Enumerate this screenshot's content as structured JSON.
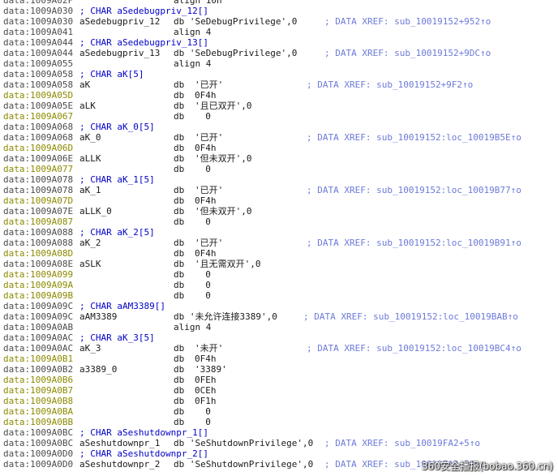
{
  "listing": [
    {
      "addr": "data:1009A02F",
      "hl": false,
      "ins": "align 10h"
    },
    {
      "addr": "data:1009A030",
      "hl": false,
      "comment": "; CHAR aSedebugpriv_12[]"
    },
    {
      "addr": "data:1009A030",
      "hl": false,
      "label": "aSedebugpriv_12",
      "inline": "db 'SeDebugPrivilege',0",
      "xref": "; DATA XREF: sub_10019152+952↑o"
    },
    {
      "addr": "data:1009A041",
      "hl": false,
      "ins": "align 4"
    },
    {
      "addr": "data:1009A044",
      "hl": false,
      "comment": "; CHAR aSedebugpriv_13[]"
    },
    {
      "addr": "data:1009A044",
      "hl": false,
      "label": "aSedebugpriv_13",
      "inline": "db 'SeDebugPrivilege',0",
      "xref": "; DATA XREF: sub_10019152+9DC↑o"
    },
    {
      "addr": "data:1009A055",
      "hl": false,
      "ins": "align 4"
    },
    {
      "addr": "data:1009A058",
      "hl": false,
      "comment": "; CHAR aK[5]"
    },
    {
      "addr": "data:1009A058",
      "hl": false,
      "label": "aK",
      "ins": "db",
      "arg": "'已开'",
      "xref": "; DATA XREF: sub_10019152+9F2↑o"
    },
    {
      "addr": "data:1009A05D",
      "hl": true,
      "ins": "db",
      "arg": "0F4h"
    },
    {
      "addr": "data:1009A05E",
      "hl": false,
      "label": "aLK",
      "ins": "db",
      "arg": "'且已双开',0"
    },
    {
      "addr": "data:1009A067",
      "hl": true,
      "ins": "db",
      "arg": "  0"
    },
    {
      "addr": "data:1009A068",
      "hl": false,
      "comment": "; CHAR aK_0[5]"
    },
    {
      "addr": "data:1009A068",
      "hl": false,
      "label": "aK_0",
      "ins": "db",
      "arg": "'已开'",
      "xref": "; DATA XREF: sub_10019152:loc_10019B5E↑o"
    },
    {
      "addr": "data:1009A06D",
      "hl": true,
      "ins": "db",
      "arg": "0F4h"
    },
    {
      "addr": "data:1009A06E",
      "hl": false,
      "label": "aLLK",
      "ins": "db",
      "arg": "'但未双开',0"
    },
    {
      "addr": "data:1009A077",
      "hl": true,
      "ins": "db",
      "arg": "  0"
    },
    {
      "addr": "data:1009A078",
      "hl": false,
      "comment": "; CHAR aK_1[5]"
    },
    {
      "addr": "data:1009A078",
      "hl": false,
      "label": "aK_1",
      "ins": "db",
      "arg": "'已开'",
      "xref": "; DATA XREF: sub_10019152:loc_10019B77↑o"
    },
    {
      "addr": "data:1009A07D",
      "hl": true,
      "ins": "db",
      "arg": "0F4h"
    },
    {
      "addr": "data:1009A07E",
      "hl": false,
      "label": "aLLK_0",
      "ins": "db",
      "arg": "'但未双开',0"
    },
    {
      "addr": "data:1009A087",
      "hl": true,
      "ins": "db",
      "arg": "  0"
    },
    {
      "addr": "data:1009A088",
      "hl": false,
      "comment": "; CHAR aK_2[5]"
    },
    {
      "addr": "data:1009A088",
      "hl": false,
      "label": "aK_2",
      "ins": "db",
      "arg": "'已开'",
      "xref": "; DATA XREF: sub_10019152:loc_10019B91↑o"
    },
    {
      "addr": "data:1009A08D",
      "hl": true,
      "ins": "db",
      "arg": "0F4h"
    },
    {
      "addr": "data:1009A08E",
      "hl": false,
      "label": "aSLK",
      "ins": "db",
      "arg": "'且无需双开',0"
    },
    {
      "addr": "data:1009A099",
      "hl": true,
      "ins": "db",
      "arg": "  0"
    },
    {
      "addr": "data:1009A09A",
      "hl": true,
      "ins": "db",
      "arg": "  0"
    },
    {
      "addr": "data:1009A09B",
      "hl": true,
      "ins": "db",
      "arg": "  0"
    },
    {
      "addr": "data:1009A09C",
      "hl": false,
      "comment": "; CHAR aAM3389[]"
    },
    {
      "addr": "data:1009A09C",
      "hl": false,
      "label": "aAM3389",
      "inline": "db '未允许连接3389',0",
      "xref": "; DATA XREF: sub_10019152:loc_10019BAB↑o"
    },
    {
      "addr": "data:1009A0AB",
      "hl": false,
      "ins": "align 4"
    },
    {
      "addr": "data:1009A0AC",
      "hl": false,
      "comment": "; CHAR aK_3[5]"
    },
    {
      "addr": "data:1009A0AC",
      "hl": false,
      "label": "aK_3",
      "ins": "db",
      "arg": "'未开'",
      "xref": "; DATA XREF: sub_10019152:loc_10019BC4↑o"
    },
    {
      "addr": "data:1009A0B1",
      "hl": true,
      "ins": "db",
      "arg": "0F4h"
    },
    {
      "addr": "data:1009A0B2",
      "hl": false,
      "label": "a3389_0",
      "ins": "db",
      "arg": "'3389'"
    },
    {
      "addr": "data:1009A0B6",
      "hl": true,
      "ins": "db",
      "arg": "0FEh"
    },
    {
      "addr": "data:1009A0B7",
      "hl": true,
      "ins": "db",
      "arg": "0CEh"
    },
    {
      "addr": "data:1009A0B8",
      "hl": true,
      "ins": "db",
      "arg": "0F1h"
    },
    {
      "addr": "data:1009A0BA",
      "hl": true,
      "ins": "db",
      "arg": "  0"
    },
    {
      "addr": "data:1009A0BB",
      "hl": true,
      "ins": "db",
      "arg": "  0"
    },
    {
      "addr": "data:1009A0BC",
      "hl": false,
      "comment": "; CHAR aSeshutdownpr_1[]"
    },
    {
      "addr": "data:1009A0BC",
      "hl": false,
      "label": "aSeshutdownpr_1",
      "inline": "db 'SeShutdownPrivilege',0",
      "xref": "; DATA XREF: sub_10019FA2+5↑o"
    },
    {
      "addr": "data:1009A0D0",
      "hl": false,
      "comment": "; CHAR aSeshutdownpr_2[]"
    },
    {
      "addr": "data:1009A0D0",
      "hl": false,
      "label": "aSeshutdownpr_2",
      "inline": "db 'SeShutdownPrivilege',0",
      "xref": "; DATA XREF: sub_10019FA2+20↑o"
    }
  ],
  "watermark": "360安全播报(bobao.360.cn)"
}
